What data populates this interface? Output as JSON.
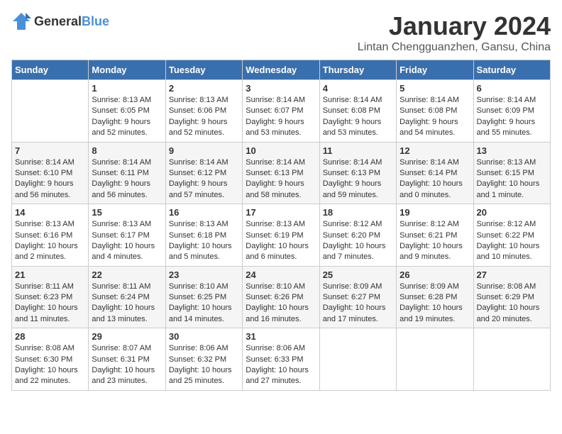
{
  "header": {
    "logo_general": "General",
    "logo_blue": "Blue",
    "title": "January 2024",
    "subtitle": "Lintan Chengguanzhen, Gansu, China"
  },
  "columns": [
    "Sunday",
    "Monday",
    "Tuesday",
    "Wednesday",
    "Thursday",
    "Friday",
    "Saturday"
  ],
  "weeks": [
    [
      {
        "day": "",
        "info": ""
      },
      {
        "day": "1",
        "info": "Sunrise: 8:13 AM\nSunset: 6:05 PM\nDaylight: 9 hours\nand 52 minutes."
      },
      {
        "day": "2",
        "info": "Sunrise: 8:13 AM\nSunset: 6:06 PM\nDaylight: 9 hours\nand 52 minutes."
      },
      {
        "day": "3",
        "info": "Sunrise: 8:14 AM\nSunset: 6:07 PM\nDaylight: 9 hours\nand 53 minutes."
      },
      {
        "day": "4",
        "info": "Sunrise: 8:14 AM\nSunset: 6:08 PM\nDaylight: 9 hours\nand 53 minutes."
      },
      {
        "day": "5",
        "info": "Sunrise: 8:14 AM\nSunset: 6:08 PM\nDaylight: 9 hours\nand 54 minutes."
      },
      {
        "day": "6",
        "info": "Sunrise: 8:14 AM\nSunset: 6:09 PM\nDaylight: 9 hours\nand 55 minutes."
      }
    ],
    [
      {
        "day": "7",
        "info": "Sunrise: 8:14 AM\nSunset: 6:10 PM\nDaylight: 9 hours\nand 56 minutes."
      },
      {
        "day": "8",
        "info": "Sunrise: 8:14 AM\nSunset: 6:11 PM\nDaylight: 9 hours\nand 56 minutes."
      },
      {
        "day": "9",
        "info": "Sunrise: 8:14 AM\nSunset: 6:12 PM\nDaylight: 9 hours\nand 57 minutes."
      },
      {
        "day": "10",
        "info": "Sunrise: 8:14 AM\nSunset: 6:13 PM\nDaylight: 9 hours\nand 58 minutes."
      },
      {
        "day": "11",
        "info": "Sunrise: 8:14 AM\nSunset: 6:13 PM\nDaylight: 9 hours\nand 59 minutes."
      },
      {
        "day": "12",
        "info": "Sunrise: 8:14 AM\nSunset: 6:14 PM\nDaylight: 10 hours\nand 0 minutes."
      },
      {
        "day": "13",
        "info": "Sunrise: 8:13 AM\nSunset: 6:15 PM\nDaylight: 10 hours\nand 1 minute."
      }
    ],
    [
      {
        "day": "14",
        "info": "Sunrise: 8:13 AM\nSunset: 6:16 PM\nDaylight: 10 hours\nand 2 minutes."
      },
      {
        "day": "15",
        "info": "Sunrise: 8:13 AM\nSunset: 6:17 PM\nDaylight: 10 hours\nand 4 minutes."
      },
      {
        "day": "16",
        "info": "Sunrise: 8:13 AM\nSunset: 6:18 PM\nDaylight: 10 hours\nand 5 minutes."
      },
      {
        "day": "17",
        "info": "Sunrise: 8:13 AM\nSunset: 6:19 PM\nDaylight: 10 hours\nand 6 minutes."
      },
      {
        "day": "18",
        "info": "Sunrise: 8:12 AM\nSunset: 6:20 PM\nDaylight: 10 hours\nand 7 minutes."
      },
      {
        "day": "19",
        "info": "Sunrise: 8:12 AM\nSunset: 6:21 PM\nDaylight: 10 hours\nand 9 minutes."
      },
      {
        "day": "20",
        "info": "Sunrise: 8:12 AM\nSunset: 6:22 PM\nDaylight: 10 hours\nand 10 minutes."
      }
    ],
    [
      {
        "day": "21",
        "info": "Sunrise: 8:11 AM\nSunset: 6:23 PM\nDaylight: 10 hours\nand 11 minutes."
      },
      {
        "day": "22",
        "info": "Sunrise: 8:11 AM\nSunset: 6:24 PM\nDaylight: 10 hours\nand 13 minutes."
      },
      {
        "day": "23",
        "info": "Sunrise: 8:10 AM\nSunset: 6:25 PM\nDaylight: 10 hours\nand 14 minutes."
      },
      {
        "day": "24",
        "info": "Sunrise: 8:10 AM\nSunset: 6:26 PM\nDaylight: 10 hours\nand 16 minutes."
      },
      {
        "day": "25",
        "info": "Sunrise: 8:09 AM\nSunset: 6:27 PM\nDaylight: 10 hours\nand 17 minutes."
      },
      {
        "day": "26",
        "info": "Sunrise: 8:09 AM\nSunset: 6:28 PM\nDaylight: 10 hours\nand 19 minutes."
      },
      {
        "day": "27",
        "info": "Sunrise: 8:08 AM\nSunset: 6:29 PM\nDaylight: 10 hours\nand 20 minutes."
      }
    ],
    [
      {
        "day": "28",
        "info": "Sunrise: 8:08 AM\nSunset: 6:30 PM\nDaylight: 10 hours\nand 22 minutes."
      },
      {
        "day": "29",
        "info": "Sunrise: 8:07 AM\nSunset: 6:31 PM\nDaylight: 10 hours\nand 23 minutes."
      },
      {
        "day": "30",
        "info": "Sunrise: 8:06 AM\nSunset: 6:32 PM\nDaylight: 10 hours\nand 25 minutes."
      },
      {
        "day": "31",
        "info": "Sunrise: 8:06 AM\nSunset: 6:33 PM\nDaylight: 10 hours\nand 27 minutes."
      },
      {
        "day": "",
        "info": ""
      },
      {
        "day": "",
        "info": ""
      },
      {
        "day": "",
        "info": ""
      }
    ]
  ]
}
